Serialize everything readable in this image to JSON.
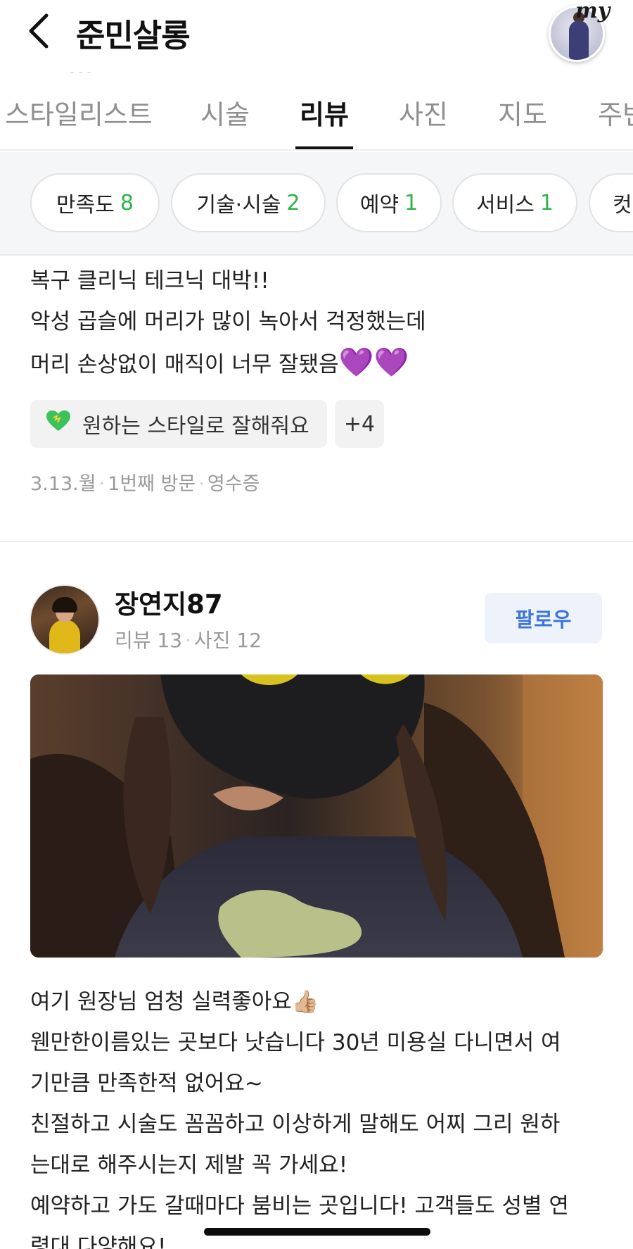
{
  "header": {
    "title": "준민살롱",
    "my_badge": "my"
  },
  "tabs": [
    {
      "label": "스타일리스트",
      "active": false
    },
    {
      "label": "시술",
      "active": false
    },
    {
      "label": "리뷰",
      "active": true
    },
    {
      "label": "사진",
      "active": false
    },
    {
      "label": "지도",
      "active": false
    },
    {
      "label": "주변",
      "active": false
    }
  ],
  "filter_chips": [
    {
      "label": "만족도",
      "count": "8"
    },
    {
      "label": "기술·시술",
      "count": "2"
    },
    {
      "label": "예약",
      "count": "1"
    },
    {
      "label": "서비스",
      "count": "1"
    },
    {
      "label": "컷",
      "count": ""
    }
  ],
  "review1": {
    "lines": [
      "복구 클리닉 테크닉 대박!!",
      "악성 곱슬에 머리가 많이 녹아서 걱정했는데",
      "머리 손상없이 매직이 너무 잘됐음"
    ],
    "hearts": "💜💜",
    "tag": "원하는 스타일로 잘해줘요",
    "more_tags": "+4",
    "meta": {
      "date": "3.13.월",
      "visit": "1번째 방문",
      "proof": "영수증"
    }
  },
  "review2": {
    "author": "장연지87",
    "review_count_label": "리뷰 13",
    "photo_count_label": "사진 12",
    "follow_label": "팔로우",
    "lines": [
      "여기 원장님 엄청 실력좋아요👍🏼",
      "웬만한이름있는 곳보다 낫습니다 30년 미용실 다니면서 여",
      "기만큼 만족한적 없어요~",
      "친절하고 시술도 꼼꼼하고 이상하게 말해도 어찌 그리 원하",
      "는대로 해주시는지 제발 꼭 가세요!",
      "예약하고 가도 갈때마다 붐비는 곳입니다! 고객들도 성별 연",
      "령대 다양해요!"
    ]
  },
  "colors": {
    "count_green": "#2fb34a",
    "follow_blue": "#3f74d9",
    "heart_purple": "#9b3ee8"
  }
}
